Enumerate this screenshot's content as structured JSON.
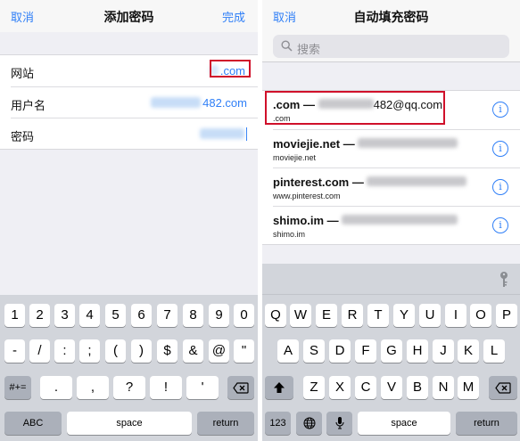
{
  "left": {
    "nav": {
      "cancel": "取消",
      "title": "添加密码",
      "done": "完成"
    },
    "form": [
      {
        "label": "网站",
        "value": ".com"
      },
      {
        "label": "用户名",
        "value": "482.com"
      },
      {
        "label": "密码",
        "value": ""
      }
    ],
    "keyboard": {
      "row1": [
        "1",
        "2",
        "3",
        "4",
        "5",
        "6",
        "7",
        "8",
        "9",
        "0"
      ],
      "row2": [
        "-",
        "/",
        ":",
        ";",
        "(",
        ")",
        "$",
        "&",
        "@",
        "\""
      ],
      "row3": [
        "#+=",
        ".",
        ",",
        "?",
        "!",
        "'"
      ],
      "row4": {
        "abc": "ABC",
        "space": "space",
        "return": "return"
      }
    }
  },
  "right": {
    "nav": {
      "cancel": "取消",
      "title": "自动填充密码"
    },
    "search": {
      "placeholder": "搜索"
    },
    "items": [
      {
        "title": ".com —",
        "account": "482@qq.com",
        "subtitle": ".com"
      },
      {
        "title": "moviejie.net —",
        "account": "",
        "subtitle": "moviejie.net"
      },
      {
        "title": "pinterest.com —",
        "account": "",
        "subtitle": "www.pinterest.com"
      },
      {
        "title": "shimo.im —",
        "account": "",
        "subtitle": "shimo.im"
      }
    ],
    "info_label": "i",
    "keyboard": {
      "row1": [
        "Q",
        "W",
        "E",
        "R",
        "T",
        "Y",
        "U",
        "I",
        "O",
        "P"
      ],
      "row2": [
        "A",
        "S",
        "D",
        "F",
        "G",
        "H",
        "J",
        "K",
        "L"
      ],
      "row3": [
        "Z",
        "X",
        "C",
        "V",
        "B",
        "N",
        "M"
      ],
      "row4": {
        "num": "123",
        "space": "space",
        "return": "return"
      }
    }
  },
  "colors": {
    "accent": "#2f7ff7",
    "highlight": "#d0102a",
    "keyboard_bg": "#d2d5db"
  },
  "icons": [
    "search-icon",
    "info-icon",
    "key-icon",
    "shift-icon",
    "backspace-icon",
    "globe-icon",
    "microphone-icon"
  ]
}
